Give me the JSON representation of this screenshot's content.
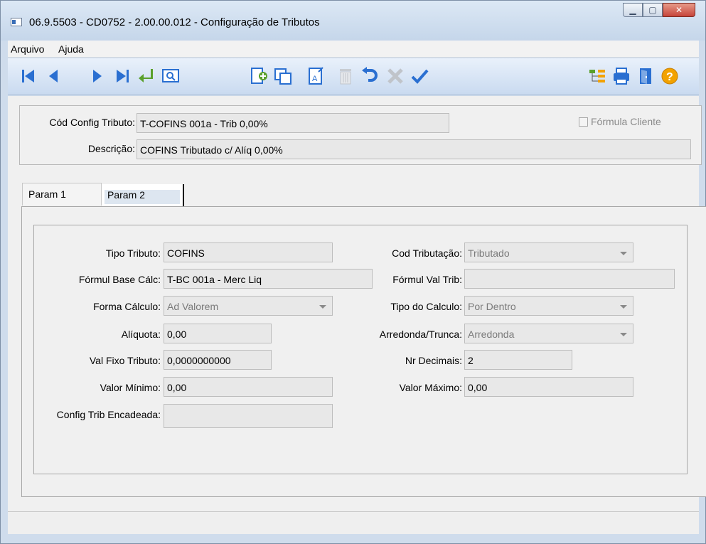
{
  "window": {
    "title": "06.9.5503 - CD0752 - 2.00.00.012 - Configuração de Tributos"
  },
  "menu": {
    "arquivo": "Arquivo",
    "ajuda": "Ajuda"
  },
  "toolbar": {
    "icons": [
      "first-record-icon",
      "previous-record-icon",
      "next-record-icon",
      "last-record-icon",
      "goto-icon",
      "search-icon",
      "new-record-icon",
      "copy-record-icon",
      "edit-record-icon",
      "delete-record-icon",
      "undo-icon",
      "cancel-icon",
      "confirm-icon",
      "tree-icon",
      "print-icon",
      "exit-icon",
      "help-icon"
    ]
  },
  "header": {
    "cod_config_label": "Cód Config Tributo:",
    "cod_config_value": "T-COFINS 001a - Trib 0,00%",
    "formula_cliente_label": "Fórmula Cliente",
    "descricao_label": "Descrição:",
    "descricao_value": "COFINS Tributado c/ Alíq 0,00%"
  },
  "tabs": {
    "param1": "Param 1",
    "param2": "Param 2"
  },
  "fields": {
    "tipo_tributo_label": "Tipo Tributo:",
    "tipo_tributo_value": "COFINS",
    "formul_base_label": "Fórmul Base Cálc:",
    "formul_base_value": "T-BC 001a - Merc Liq",
    "forma_calculo_label": "Forma Cálculo:",
    "forma_calculo_value": "Ad Valorem",
    "aliquota_label": "Alíquota:",
    "aliquota_value": "0,00",
    "val_fixo_label": "Val Fixo Tributo:",
    "val_fixo_value": "0,0000000000",
    "valor_minimo_label": "Valor Mínimo:",
    "valor_minimo_value": "0,00",
    "config_trib_label": "Config Trib Encadeada:",
    "config_trib_value": "",
    "cod_tributacao_label": "Cod Tributação:",
    "cod_tributacao_value": "Tributado",
    "formul_val_trib_label": "Fórmul Val Trib:",
    "formul_val_trib_value": "",
    "tipo_calculo_label": "Tipo do Calculo:",
    "tipo_calculo_value": "Por Dentro",
    "arredonda_label": "Arredonda/Trunca:",
    "arredonda_value": "Arredonda",
    "nr_decimais_label": "Nr Decimais:",
    "nr_decimais_value": "2",
    "valor_maximo_label": "Valor Máximo:",
    "valor_maximo_value": "0,00"
  },
  "colors": {
    "nav_blue": "#2a6fd1",
    "confirm_green": "#5aa02c",
    "help_orange": "#f2a200"
  }
}
